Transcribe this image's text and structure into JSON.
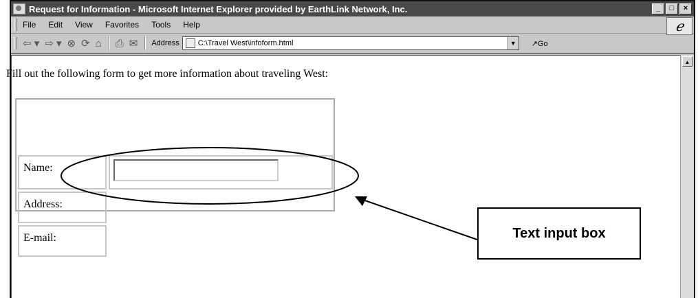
{
  "window": {
    "title": "Request for Information - Microsoft Internet Explorer provided by EarthLink Network, Inc.",
    "controls": [
      "_",
      "□",
      "×"
    ]
  },
  "menu": [
    "File",
    "Edit",
    "View",
    "Favorites",
    "Tools",
    "Help"
  ],
  "toolbar": {
    "address_label": "Address",
    "address_value": "C:\\Travel West\\infoform.html",
    "go_label": "Go"
  },
  "page": {
    "intro": "Fill out the following form to get more information about traveling West:",
    "form": {
      "labels": [
        "Name:",
        "Address:",
        "E-mail:"
      ],
      "name_value": ""
    }
  },
  "annotation": {
    "callout": "Text input box"
  }
}
